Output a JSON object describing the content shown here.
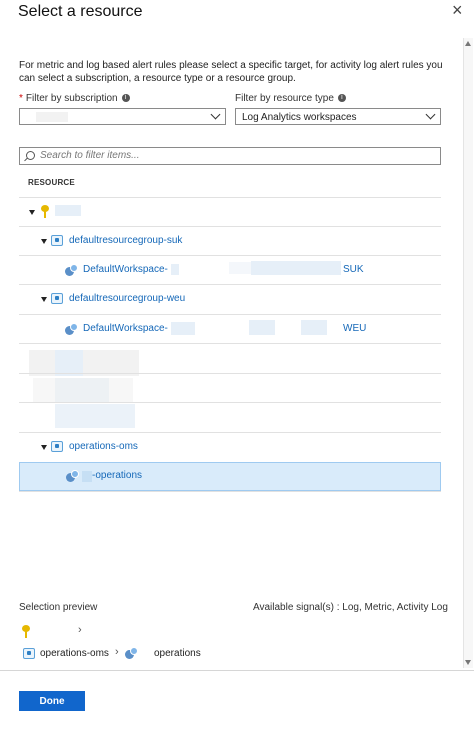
{
  "window": {
    "title": "Select a resource"
  },
  "description": "For metric and log based alert rules please select a specific target, for activity log alert rules you can select a subscription, a resource type or a resource group.",
  "filters": {
    "subscription_label": "Filter by subscription",
    "subscription_required": "*",
    "subscription_value": "",
    "resource_type_label": "Filter by resource type",
    "resource_type_value": "Log Analytics workspaces"
  },
  "search": {
    "placeholder": "Search to filter items..."
  },
  "table": {
    "header": "RESOURCE"
  },
  "tree": {
    "rg_suk": "defaultresourcegroup-suk",
    "ws_suk_prefix": "DefaultWorkspace-",
    "ws_suk_suffix": "SUK",
    "rg_weu": "defaultresourcegroup-weu",
    "ws_weu_prefix": "DefaultWorkspace-",
    "ws_weu_suffix": "WEU",
    "rg_oms": "operations-oms",
    "ws_oms_suffix": "-operations"
  },
  "preview": {
    "label": "Selection preview",
    "signals": "Available signal(s) : Log, Metric, Activity Log",
    "path_rg": "operations-oms",
    "path_ws": "operations"
  },
  "buttons": {
    "done": "Done",
    "close": "×"
  },
  "colors": {
    "accent": "#1166cc",
    "link": "#1568b8",
    "selected_row": "#d9ebfa",
    "key": "#e6b800"
  }
}
